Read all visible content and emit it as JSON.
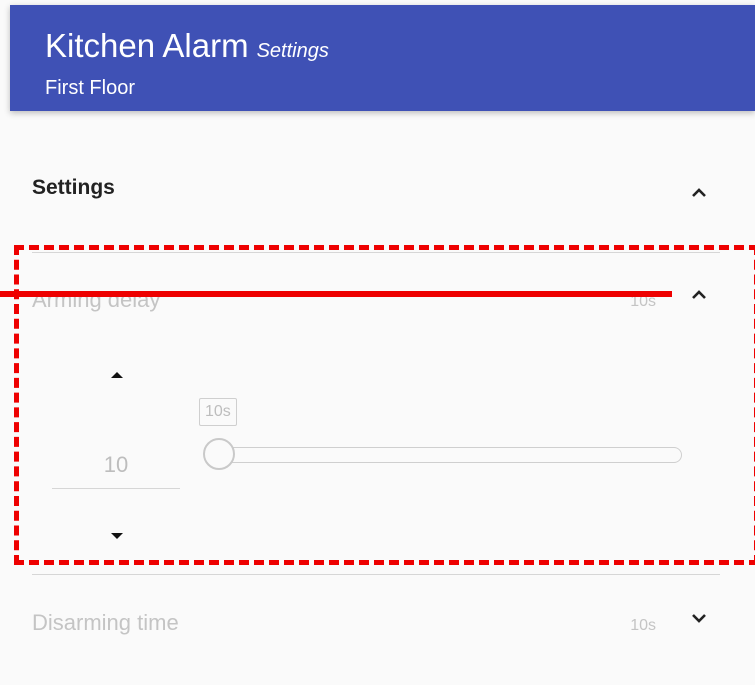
{
  "header": {
    "title": "Kitchen Alarm",
    "title_suffix": "Settings",
    "subtitle": "First Floor",
    "color": "#3f51b5"
  },
  "settings_section": {
    "label": "Settings",
    "toggle_icon": "chevron-up-icon"
  },
  "arming_delay": {
    "label": "Arming delay",
    "value": "10s",
    "toggle_icon": "chevron-up-icon",
    "number_value": "10",
    "increment_icon": "caret-up-icon",
    "decrement_icon": "caret-down-icon",
    "slider_tooltip": "10s",
    "slider_fraction": 0
  },
  "disarming_time": {
    "label": "Disarming time",
    "value": "10s",
    "toggle_icon": "chevron-down-icon"
  },
  "annotation": {
    "color": "#ee0000"
  }
}
